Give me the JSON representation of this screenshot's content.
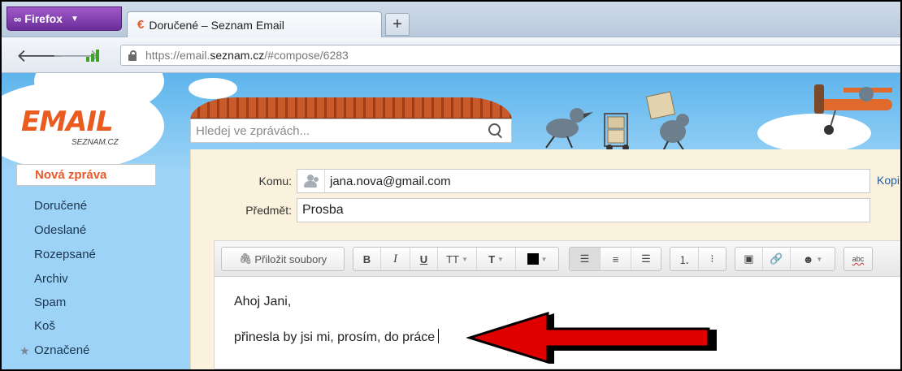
{
  "browser": {
    "menu_button": "Firefox",
    "tab_title": "Doručené – Seznam Email",
    "new_tab": "+",
    "url_prefix": "https://email.",
    "url_domain": "seznam.cz",
    "url_path": "/#compose/6283"
  },
  "logo": {
    "main": "EMAIL",
    "sub": "SEZNAM.CZ"
  },
  "search": {
    "placeholder": "Hledej ve zprávách..."
  },
  "sidebar": {
    "new_message": "Nová zpráva",
    "items": [
      "Doručené",
      "Odeslané",
      "Rozepsané",
      "Archiv",
      "Spam",
      "Koš",
      "Označené"
    ]
  },
  "compose": {
    "to_label": "Komu:",
    "to_value": "jana.nova@gmail.com",
    "subject_label": "Předmět:",
    "subject_value": "Prosba",
    "copy_link": "Kopi",
    "toolbar": {
      "attach": "Přiložit soubory",
      "bold": "B",
      "italic": "I",
      "underline": "U",
      "font_size": "TT",
      "font": "T"
    },
    "body_line1": "Ahoj Jani,",
    "body_line2": "přinesla by jsi mi, prosím, do práce"
  },
  "colors": {
    "accent": "#e8592a",
    "sky": "#7cc4f2",
    "compose_bg": "#fbf2de",
    "arrow": "#e00000"
  }
}
